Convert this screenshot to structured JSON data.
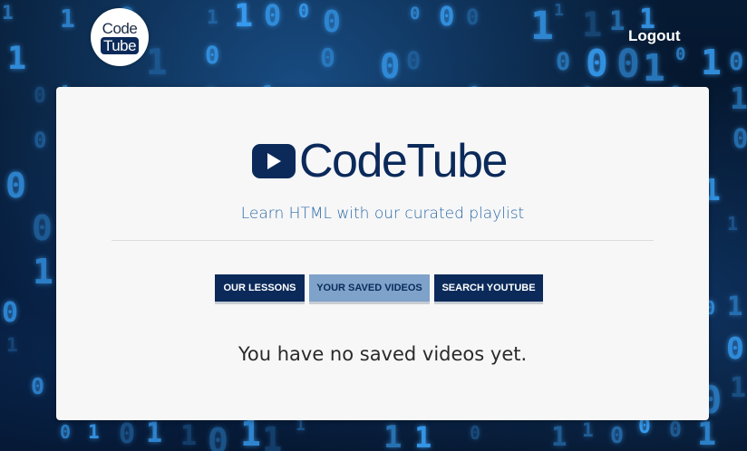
{
  "header": {
    "logo_top": "Code",
    "logo_bottom": "Tube",
    "logout_label": "Logout"
  },
  "card": {
    "brand_name": "CodeTube",
    "tagline": "Learn HTML with our curated playlist",
    "tabs": [
      {
        "label": "OUR LESSONS",
        "active": false
      },
      {
        "label": "YOUR SAVED VIDEOS",
        "active": true
      },
      {
        "label": "SEARCH YOUTUBE",
        "active": false
      }
    ],
    "empty_message": "You have no saved videos yet."
  },
  "colors": {
    "brand_navy": "#0b2a5a",
    "active_tab": "#7ea2c9",
    "tagline_blue": "#2b6aa6",
    "card_bg": "#f7f7f8"
  },
  "icons": {
    "logo": "codetube-logo-icon",
    "brand_play": "play-button-icon"
  }
}
